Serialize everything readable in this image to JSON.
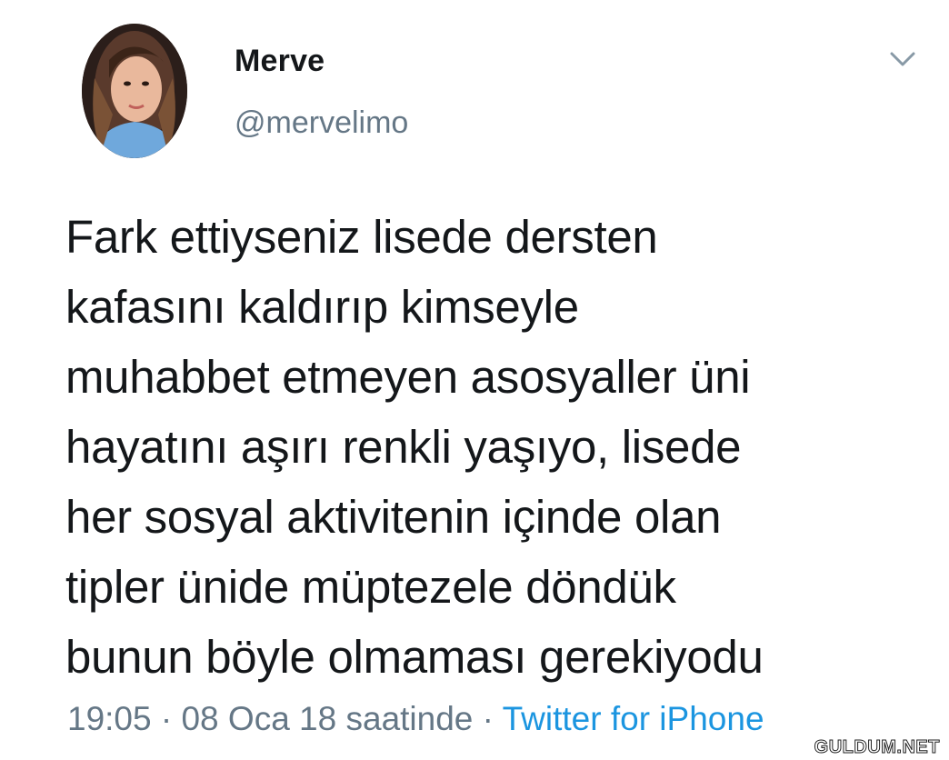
{
  "author": {
    "name": "Merve",
    "handle": "@mervelimo"
  },
  "tweet": {
    "text": "Fark ettiyseniz lisede dersten\nkafasını kaldırıp kimseyle\nmuhabbet etmeyen asosyaller üni\nhayatını aşırı renkli yaşıyo, lisede\nher sosyal aktivitenin içinde olan\ntipler ünide müptezele döndük\nbunun böyle olmaması gerekiyodu"
  },
  "meta": {
    "time": "19:05",
    "separator": " · ",
    "date": "08 Oca 18 saatinde",
    "source": "Twitter for iPhone"
  },
  "icons": {
    "menu": "chevron-down-icon"
  },
  "colors": {
    "text": "#14171a",
    "secondary": "#657786",
    "link": "#1b95e0"
  },
  "watermark": "GULDUM.NET"
}
